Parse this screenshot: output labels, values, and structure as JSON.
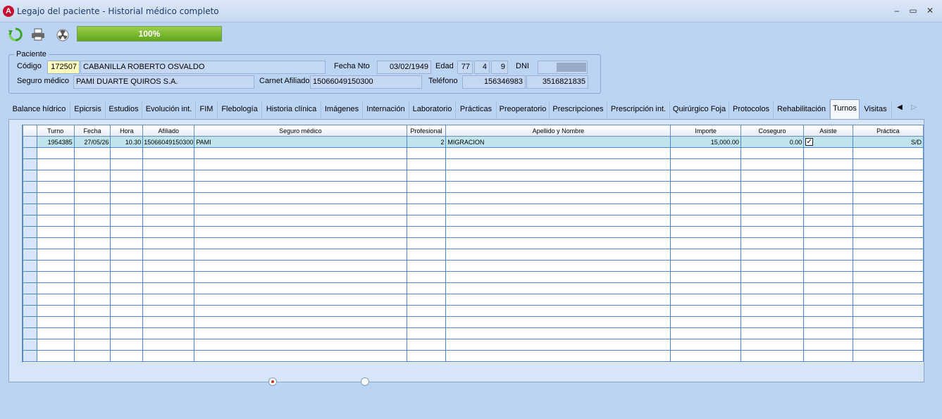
{
  "window": {
    "title": "Legajo del paciente - Historial médico completo",
    "app_icon": "app-logo-icon",
    "buttons": {
      "minimize": "–",
      "maximize": "▭",
      "close": "✕"
    }
  },
  "toolbar": {
    "refresh_icon": "refresh-icon",
    "print_icon": "printer-icon",
    "radiation_icon": "radiation-icon",
    "progress_text": "100%",
    "progress_value": 100
  },
  "patient": {
    "legend": "Paciente",
    "codigo_label": "Código",
    "codigo": "172507",
    "nombre": "CABANILLA ROBERTO OSVALDO",
    "fecha_nto_label": "Fecha Nto",
    "fecha_nto": "03/02/1949",
    "edad_label": "Edad",
    "edad_anios": "77",
    "edad_meses": "4",
    "edad_dias": "9",
    "dni_label": "DNI",
    "dni": "",
    "seguro_label": "Seguro médico",
    "seguro": "PAMI DUARTE QUIROS S.A.",
    "carnet_label": "Carnet Afiliado",
    "carnet": "15066049150300",
    "telefono_label": "Teléfono",
    "telefono1": "156346983",
    "telefono2": "3516821835"
  },
  "tabs": [
    "Balance hídrico",
    "Epicrsis",
    "Estudios",
    "Evolución int.",
    "FIM",
    "Flebología",
    "Historia clínica",
    "Imágenes",
    "Internación",
    "Laboratorio",
    "Prácticas",
    "Preoperatorio",
    "Prescripciones",
    "Prescripción int.",
    "Quirúrgico Foja",
    "Protocolos",
    "Rehabilitación",
    "Turnos",
    "Visitas"
  ],
  "active_tab": "Turnos",
  "tab_nav": {
    "left": "◀",
    "right": "▷"
  },
  "grid": {
    "columns": [
      "Turno",
      "Fecha",
      "Hora",
      "Afiliado",
      "Seguro médico",
      "Profesional",
      "Apellido y Nombre",
      "Importe",
      "Coseguro",
      "Asiste",
      "Práctica"
    ],
    "rows": [
      {
        "Turno": "1954385",
        "Fecha": "27/05/26",
        "Hora": "10.30",
        "Afiliado": "15066049150300",
        "Seguro médico": "PAMI",
        "Profesional": "2",
        "Apellido y Nombre": "MIGRACION",
        "Importe": "15,000.00",
        "Coseguro": "0.00",
        "Asiste": true,
        "Práctica": "S/D"
      }
    ]
  },
  "colors": {
    "window_bg": "#bcd4f4",
    "grid_line": "#4a87cf",
    "selected_row": "#c0e4ec",
    "progress": "#6db325",
    "codigo_bg": "#ffffc0"
  }
}
